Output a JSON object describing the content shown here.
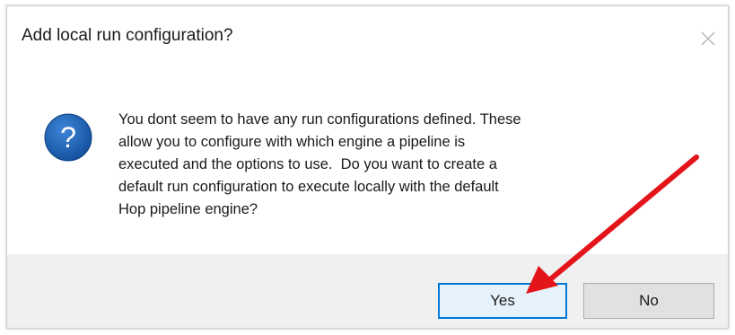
{
  "dialog": {
    "title": "Add local run configuration?",
    "message": "You dont seem to have any run configurations defined. These\nallow you to configure with which engine a pipeline is\nexecuted and the options to use.  Do you want to create a\ndefault run configuration to execute locally with the default\nHop pipeline engine?",
    "icon": "question-icon",
    "icon_color": "#1a5fb4",
    "buttons": {
      "yes_label": "Yes",
      "no_label": "No"
    },
    "accent_color": "#0078d7",
    "annotation_arrow_color": "#e3141a"
  }
}
